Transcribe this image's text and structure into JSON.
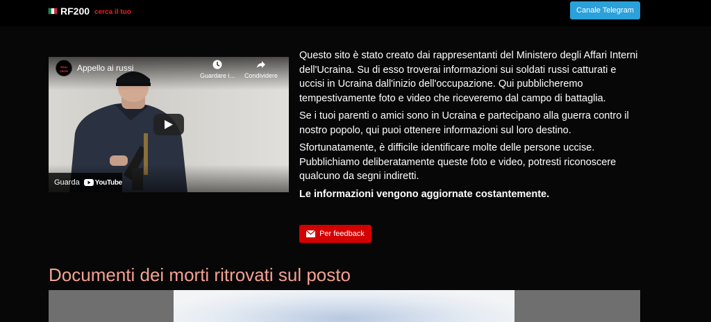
{
  "navbar": {
    "brand_name": "RF200",
    "brand_tagline": "cerca il tuo",
    "telegram_button": "Canale Telegram"
  },
  "video": {
    "channel_logo_text": "ВАШ СВОЇХ",
    "title": "Appello ai russi",
    "watch_later": "Guardare i...",
    "share": "Condividere",
    "watch_on": "Guarda",
    "youtube": "YouTube"
  },
  "intro": {
    "paragraph_1": "Questo sito è stato creato dai rappresentanti del Ministero degli Affari Interni dell'Ucraina. Su di esso troverai informazioni sui soldati russi catturati e uccisi in Ucraina dall'inizio dell'occupazione. Qui pubblicheremo tempestivamente foto e video che riceveremo dal campo di battaglia.",
    "paragraph_2": "Se i tuoi parenti o amici sono in Ucraina e partecipano alla guerra contro il nostro popolo, qui puoi ottenere informazioni sul loro destino.",
    "paragraph_3": "Sfortunatamente, è difficile identificare molte delle persone uccise. Pubblichiamo deliberatamente queste foto e video, potresti riconoscere qualcuno da segni indiretti.",
    "notice": "Le informazioni vengono aggiornate costantemente."
  },
  "feedback_button": "Per feedback",
  "section": {
    "title": "Documenti dei morti ritrovati sul posto"
  },
  "colors": {
    "telegram_button": "#2aa1da",
    "feedback_button": "#d40000",
    "section_title": "#f4a192",
    "brand_tagline": "#ff1a1a"
  }
}
